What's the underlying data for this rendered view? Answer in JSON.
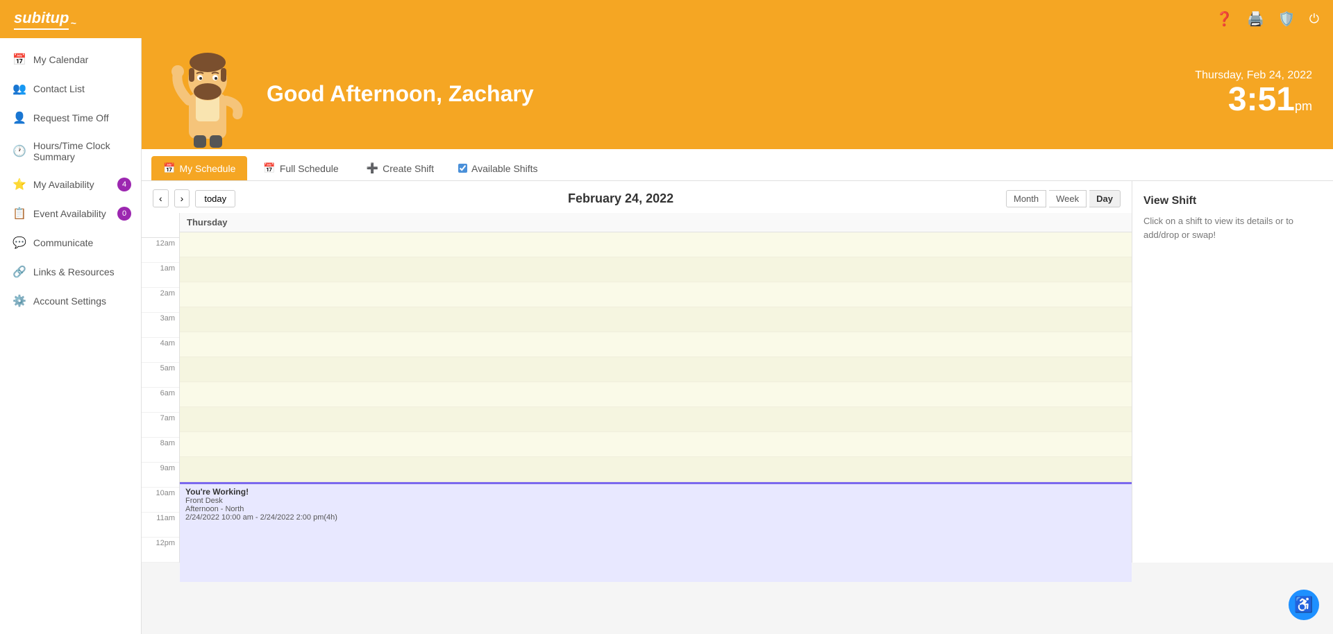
{
  "app": {
    "name": "subitup",
    "tagline": "~"
  },
  "top_icons": {
    "help": "?",
    "print": "🖨",
    "shield": "🛡",
    "power": "⏻"
  },
  "sidebar": {
    "items": [
      {
        "id": "my-calendar",
        "label": "My Calendar",
        "icon": "📅",
        "badge": null
      },
      {
        "id": "contact-list",
        "label": "Contact List",
        "icon": "👥",
        "badge": null
      },
      {
        "id": "request-time-off",
        "label": "Request Time Off",
        "icon": "👤",
        "badge": null
      },
      {
        "id": "hours-time-clock",
        "label": "Hours/Time Clock Summary",
        "icon": "🕐",
        "badge": null
      },
      {
        "id": "my-availability",
        "label": "My Availability",
        "icon": "⭐",
        "badge": "4"
      },
      {
        "id": "event-availability",
        "label": "Event Availability",
        "icon": "📋",
        "badge": "0"
      },
      {
        "id": "communicate",
        "label": "Communicate",
        "icon": "💬",
        "badge": null
      },
      {
        "id": "links-resources",
        "label": "Links & Resources",
        "icon": "🔗",
        "badge": null
      },
      {
        "id": "account-settings",
        "label": "Account Settings",
        "icon": "⚙",
        "badge": null
      }
    ]
  },
  "banner": {
    "greeting": "Good Afternoon, Zachary",
    "date": "Thursday, Feb 24, 2022",
    "time": "3:51",
    "time_suffix": "pm"
  },
  "tabs": [
    {
      "id": "my-schedule",
      "label": "My Schedule",
      "active": true
    },
    {
      "id": "full-schedule",
      "label": "Full Schedule",
      "active": false
    },
    {
      "id": "create-shift",
      "label": "Create Shift",
      "active": false
    }
  ],
  "available_shifts": {
    "label": "Available Shifts",
    "checked": true
  },
  "calendar": {
    "current_date": "February 24, 2022",
    "day_label": "Thursday",
    "view_buttons": [
      "Month",
      "Week",
      "Day"
    ],
    "active_view": "Day"
  },
  "time_slots": [
    "12am",
    "1am",
    "2am",
    "3am",
    "4am",
    "5am",
    "6am",
    "7am",
    "8am",
    "9am",
    "10am",
    "11am",
    "12pm"
  ],
  "shift": {
    "title": "You're Working!",
    "location": "Front Desk",
    "position": "Afternoon - North",
    "time_range": "2/24/2022 10:00 am - 2/24/2022 2:00 pm(4h)"
  },
  "view_shift_panel": {
    "title": "View Shift",
    "description": "Click on a shift to view its details or to add/drop or swap!"
  }
}
